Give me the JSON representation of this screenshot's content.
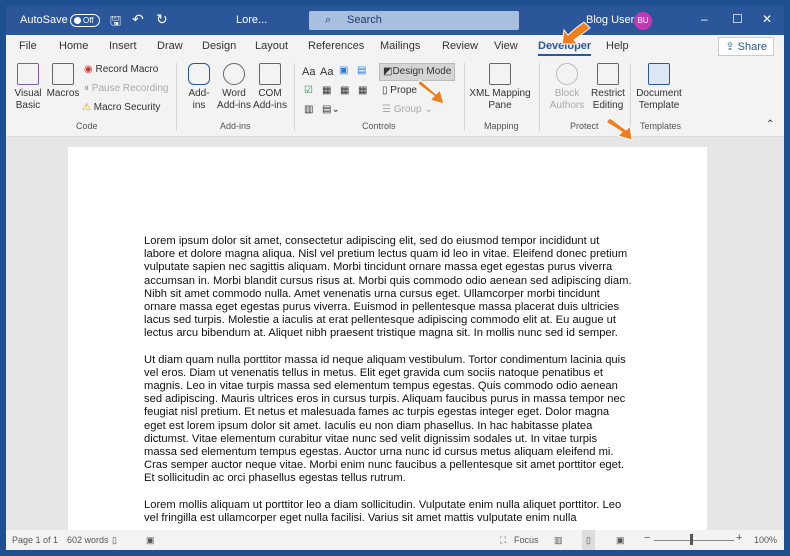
{
  "titlebar": {
    "autosave": "AutoSave",
    "toggle": "Off",
    "doc_name": "Lore...",
    "search": "Search",
    "user": "Blog User",
    "initials": "BU"
  },
  "tabs": [
    "File",
    "Home",
    "Insert",
    "Draw",
    "Design",
    "Layout",
    "References",
    "Mailings",
    "Review",
    "View",
    "Developer",
    "Help"
  ],
  "share": "Share",
  "ribbon": {
    "code": {
      "visual_basic": "Visual Basic",
      "macros": "Macros",
      "record": "Record Macro",
      "pause": "Pause Recording",
      "security": "Macro Security",
      "label": "Code"
    },
    "addins": {
      "addins": "Add-ins",
      "word": "Word Add-ins",
      "com": "COM Add-ins",
      "label": "Add-ins"
    },
    "controls": {
      "aa1": "Aa",
      "aa2": "Aa",
      "design_mode": "Design Mode",
      "properties": "Prope",
      "group": "Group",
      "label": "Controls"
    },
    "mapping": {
      "xml": "XML Mapping Pane",
      "label": "Mapping"
    },
    "protect": {
      "block": "Block Authors",
      "restrict": "Restrict Editing",
      "label": "Protect"
    },
    "templates": {
      "doc": "Document Template",
      "label": "Templates"
    }
  },
  "document": {
    "paragraphs": [
      "Lorem ipsum dolor sit amet, consectetur adipiscing elit, sed do eiusmod tempor incididunt ut labore et dolore magna aliqua. Nisl vel pretium lectus quam id leo in vitae. Eleifend donec pretium vulputate sapien nec sagittis aliquam. Morbi tincidunt ornare massa eget egestas purus viverra accumsan in. Morbi blandit cursus risus at. Morbi quis commodo odio aenean sed adipiscing diam. Nibh sit amet commodo nulla. Amet venenatis urna cursus eget. Ullamcorper morbi tincidunt ornare massa eget egestas purus viverra. Euismod in pellentesque massa placerat duis ultricies lacus sed turpis. Molestie a iaculis at erat pellentesque adipiscing commodo elit at. Eu augue ut lectus arcu bibendum at. Aliquet nibh praesent tristique magna sit. In mollis nunc sed id semper.",
      "Ut diam quam nulla porttitor massa id neque aliquam vestibulum. Tortor condimentum lacinia quis vel eros. Diam ut venenatis tellus in metus. Elit eget gravida cum sociis natoque penatibus et magnis. Leo in vitae turpis massa sed elementum tempus egestas. Quis commodo odio aenean sed adipiscing. Mauris ultrices eros in cursus turpis. Aliquam faucibus purus in massa tempor nec feugiat nisl pretium. Et netus et malesuada fames ac turpis egestas integer eget. Dolor magna eget est lorem ipsum dolor sit amet. Iaculis eu non diam phasellus. In hac habitasse platea dictumst. Vitae elementum curabitur vitae nunc sed velit dignissim sodales ut. In vitae turpis massa sed elementum tempus egestas. Auctor urna nunc id cursus metus aliquam eleifend mi. Cras semper auctor neque vitae. Morbi enim nunc faucibus a pellentesque sit amet porttitor eget. Et sollicitudin ac orci phasellus egestas tellus rutrum.",
      "Lorem mollis aliquam ut porttitor leo a diam sollicitudin. Vulputate enim nulla aliquet porttitor. Leo vel fringilla est ullamcorper eget nulla facilisi. Varius sit amet mattis vulputate enim nulla"
    ]
  },
  "status": {
    "page": "Page 1 of 1",
    "words": "602 words",
    "focus": "Focus",
    "zoom": "100%"
  }
}
